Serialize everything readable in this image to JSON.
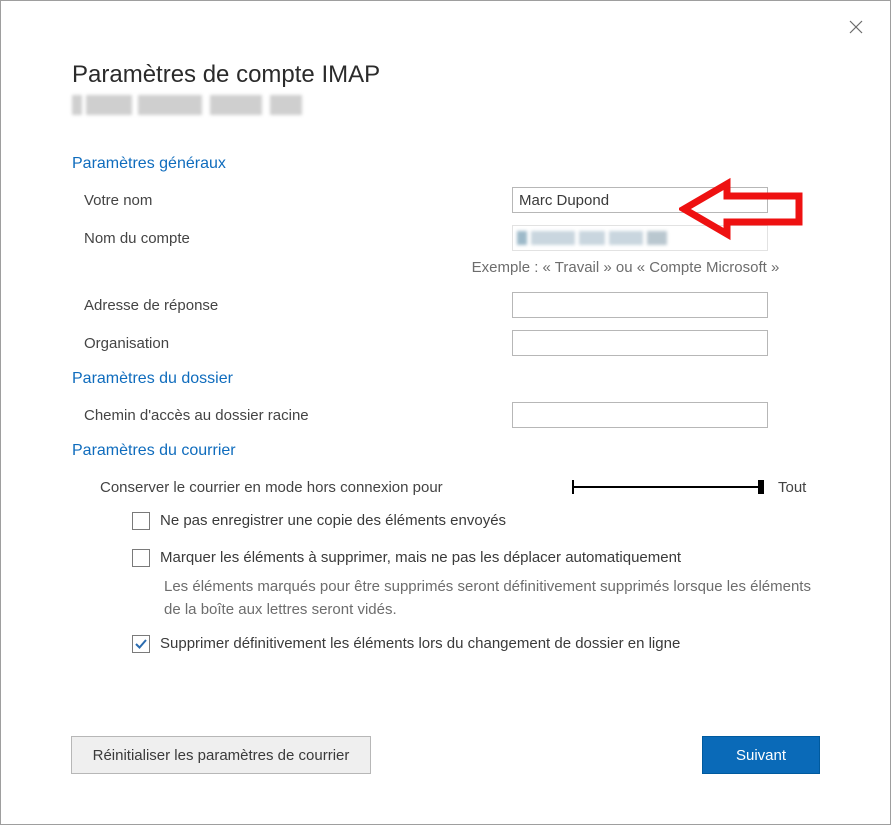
{
  "dialog": {
    "title": "Paramètres de compte IMAP"
  },
  "sections": {
    "general": {
      "heading": "Paramètres généraux",
      "your_name_label": "Votre nom",
      "your_name_value": "Marc Dupond",
      "account_name_label": "Nom du compte",
      "example_hint": "Exemple : « Travail » ou « Compte Microsoft »",
      "reply_address_label": "Adresse de réponse",
      "reply_address_value": "",
      "organization_label": "Organisation",
      "organization_value": ""
    },
    "folder": {
      "heading": "Paramètres du dossier",
      "root_path_label": "Chemin d'accès au dossier racine",
      "root_path_value": ""
    },
    "mail": {
      "heading": "Paramètres du courrier",
      "offline_label": "Conserver le courrier en mode hors connexion pour",
      "offline_value": "Tout",
      "cb_no_save_sent": "Ne pas enregistrer une copie des éléments envoyés",
      "cb_mark_delete": "Marquer les éléments à supprimer, mais ne pas les déplacer automatiquement",
      "mark_delete_help": "Les éléments marqués pour être supprimés seront définitivement supprimés lorsque les éléments de la boîte aux lettres seront vidés.",
      "cb_purge": "Supprimer définitivement les éléments lors du changement de dossier en ligne"
    }
  },
  "buttons": {
    "reset": "Réinitialiser les paramètres de courrier",
    "next": "Suivant"
  },
  "checkbox_state": {
    "no_save_sent": false,
    "mark_delete": false,
    "purge": true
  }
}
